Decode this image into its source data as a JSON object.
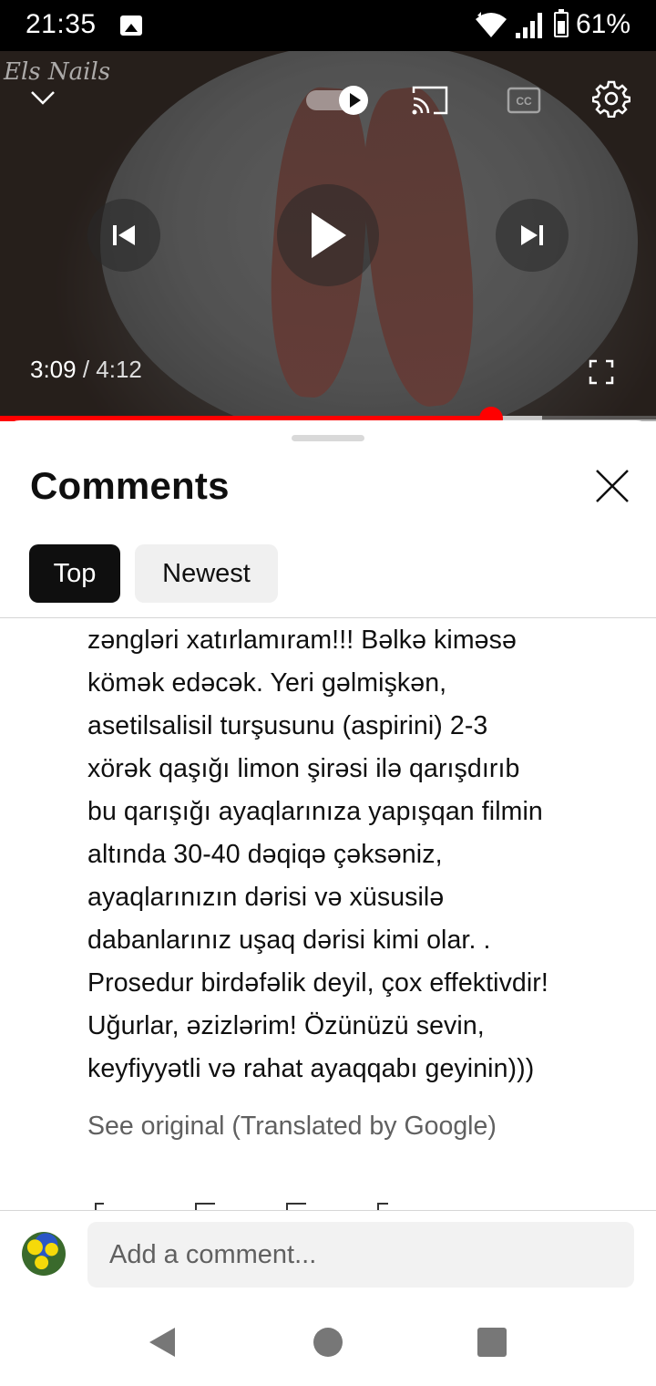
{
  "status_bar": {
    "time": "21:35",
    "battery_percent": "61%",
    "icons": [
      "image-icon",
      "wifi-icon",
      "signal-icon",
      "battery-icon"
    ]
  },
  "player": {
    "channel_watermark": "Els Nails",
    "current_time": "3:09",
    "separator": " / ",
    "duration": "4:12",
    "progress_fraction": 0.748,
    "buffered_fraction": 0.826,
    "autoplay_on": true,
    "accent_color": "#ff0000",
    "icons": [
      "chevron-down-icon",
      "autoplay-toggle",
      "cast-icon",
      "closed-captions-icon",
      "settings-icon",
      "previous-icon",
      "play-icon",
      "next-icon",
      "fullscreen-icon"
    ]
  },
  "comments": {
    "title": "Comments",
    "chips": [
      {
        "label": "Top",
        "selected": true
      },
      {
        "label": "Newest",
        "selected": false
      }
    ],
    "comment_lines": [
      "zəngləri xatırlamıram!!! Bəlkə kiməsə",
      "kömək edəcək. Yeri gəlmişkən,",
      "asetilsalisil turşusunu (aspirini) 2-3",
      "xörək qaşığı limon şirəsi ilə qarışdırıb",
      "bu qarışığı ayaqlarınıza yapışqan filmin",
      "altında 30-40 dəqiqə çəksəniz,",
      "ayaqlarınızın dərisi və xüsusilə",
      "dabanlarınız uşaq dərisi kimi olar. .",
      "Prosedur birdəfəlik deyil, çox effektivdir!",
      "Uğurlar, əzizlərim! Özünüzü sevin,",
      "keyfiyyətli və rahat ayaqqabı geyinin)))"
    ],
    "see_original": "See original (Translated by Google)",
    "add_comment_placeholder": "Add a comment..."
  },
  "nav_bar": {
    "icons": [
      "back-icon",
      "home-icon",
      "recents-icon"
    ]
  }
}
